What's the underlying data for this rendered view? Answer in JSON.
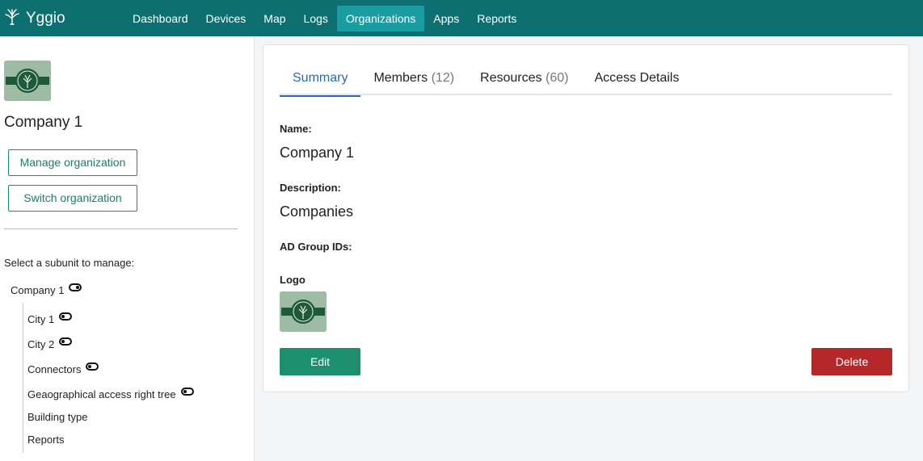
{
  "app": {
    "name": "Yggio",
    "logo_icon": "tree-logo-icon"
  },
  "nav": {
    "items": [
      {
        "label": "Dashboard"
      },
      {
        "label": "Devices"
      },
      {
        "label": "Map"
      },
      {
        "label": "Logs"
      },
      {
        "label": "Organizations",
        "active": true
      },
      {
        "label": "Apps"
      },
      {
        "label": "Reports"
      }
    ]
  },
  "sidebar": {
    "org_name": "Company 1",
    "manage_label": "Manage organization",
    "switch_label": "Switch organization",
    "subunit_prompt": "Select a subunit to manage:",
    "tree": {
      "root": {
        "label": "Company 1",
        "toggle": "on"
      },
      "children": [
        {
          "label": "City 1",
          "toggle": "off"
        },
        {
          "label": "City 2",
          "toggle": "off"
        },
        {
          "label": "Connectors",
          "toggle": "off"
        },
        {
          "label": "Geaographical access right tree",
          "toggle": "off"
        },
        {
          "label": "Building type",
          "toggle": null
        },
        {
          "label": "Reports",
          "toggle": null
        }
      ]
    }
  },
  "main": {
    "tabs": [
      {
        "label": "Summary",
        "count": "",
        "active": true
      },
      {
        "label": "Members",
        "count": "(12)"
      },
      {
        "label": "Resources",
        "count": "(60)"
      },
      {
        "label": "Access Details",
        "count": ""
      }
    ],
    "name_label": "Name:",
    "name_value": "Company 1",
    "description_label": "Description:",
    "description_value": "Companies",
    "ad_group_label": "AD Group IDs:",
    "logo_label": "Logo",
    "edit_label": "Edit",
    "delete_label": "Delete"
  },
  "colors": {
    "topbar": "#0d6f70",
    "nav_active": "#1a9da2",
    "accent_green": "#1b8f6e",
    "tab_active": "#2a6bb0",
    "danger": "#b5282a"
  }
}
